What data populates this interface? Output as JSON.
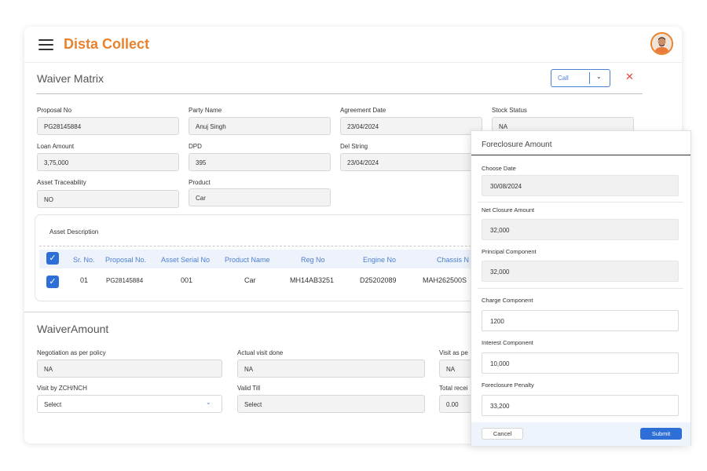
{
  "app": {
    "brand": "Dista Collect",
    "accent_color": "#e8822e",
    "primary_color": "#2d6fd6"
  },
  "waiver_matrix": {
    "title": "Waiver Matrix",
    "call_select": {
      "value": "Call"
    },
    "fields": {
      "proposal_no": {
        "label": "Proposal No",
        "value": "PG28145884"
      },
      "party_name": {
        "label": "Party Name",
        "value": "Anuj Singh"
      },
      "agreement_date": {
        "label": "Agreement Date",
        "value": "23/04/2024"
      },
      "stock_status": {
        "label": "Stock Status",
        "value": "NA"
      },
      "loan_amount": {
        "label": "Loan Amount",
        "value": "3,75,000"
      },
      "dpd": {
        "label": "DPD",
        "value": "395"
      },
      "del_string": {
        "label": "Del String",
        "value": "23/04/2024"
      },
      "asset_traceability": {
        "label": "Asset Traceability",
        "value": "NO"
      },
      "product": {
        "label": "Product",
        "value": "Car"
      }
    }
  },
  "asset_description": {
    "title": "Asset Description",
    "columns": [
      "Sr. No.",
      "Proposal No.",
      "Asset Serial No",
      "Product Name",
      "Reg No",
      "Engine No",
      "Chassis N"
    ],
    "rows": [
      [
        "01",
        "PG28145884",
        "001",
        "Car",
        "MH14AB3251",
        "D25202089",
        "MAH262500S"
      ]
    ]
  },
  "waiver_amount": {
    "title": "WaiverAmount",
    "fields": {
      "negotiation": {
        "label": "Negotiation as per policy",
        "value": "NA"
      },
      "actual_visit": {
        "label": "Actual visit done",
        "value": "NA"
      },
      "visit_as_per": {
        "label": "Visit as pe",
        "value": "NA"
      },
      "visit_by": {
        "label": "Visit by ZCH/NCH",
        "value": "Select"
      },
      "valid_till": {
        "label": "Valid Till",
        "value": "Select"
      },
      "total_received": {
        "label": "Total recei",
        "value": "0.00"
      }
    }
  },
  "foreclosure_modal": {
    "title": "Foreclosure Amount",
    "choose_date": {
      "label": "Choose Date",
      "value": "30/08/2024"
    },
    "net_closure_amount": {
      "label": "Net Closure Amount",
      "value": "32,000"
    },
    "principal_component": {
      "label": "Principal Component",
      "value": "32,000"
    },
    "charge_component": {
      "label": "Charge Component",
      "value": "1200"
    },
    "interest_component": {
      "label": "Interest Component",
      "value": "10,000"
    },
    "foreclosure_penalty": {
      "label": "Foreclosure Penalty",
      "value": "33,200"
    },
    "cancel_label": "Cancel",
    "submit_label": "Submit"
  }
}
